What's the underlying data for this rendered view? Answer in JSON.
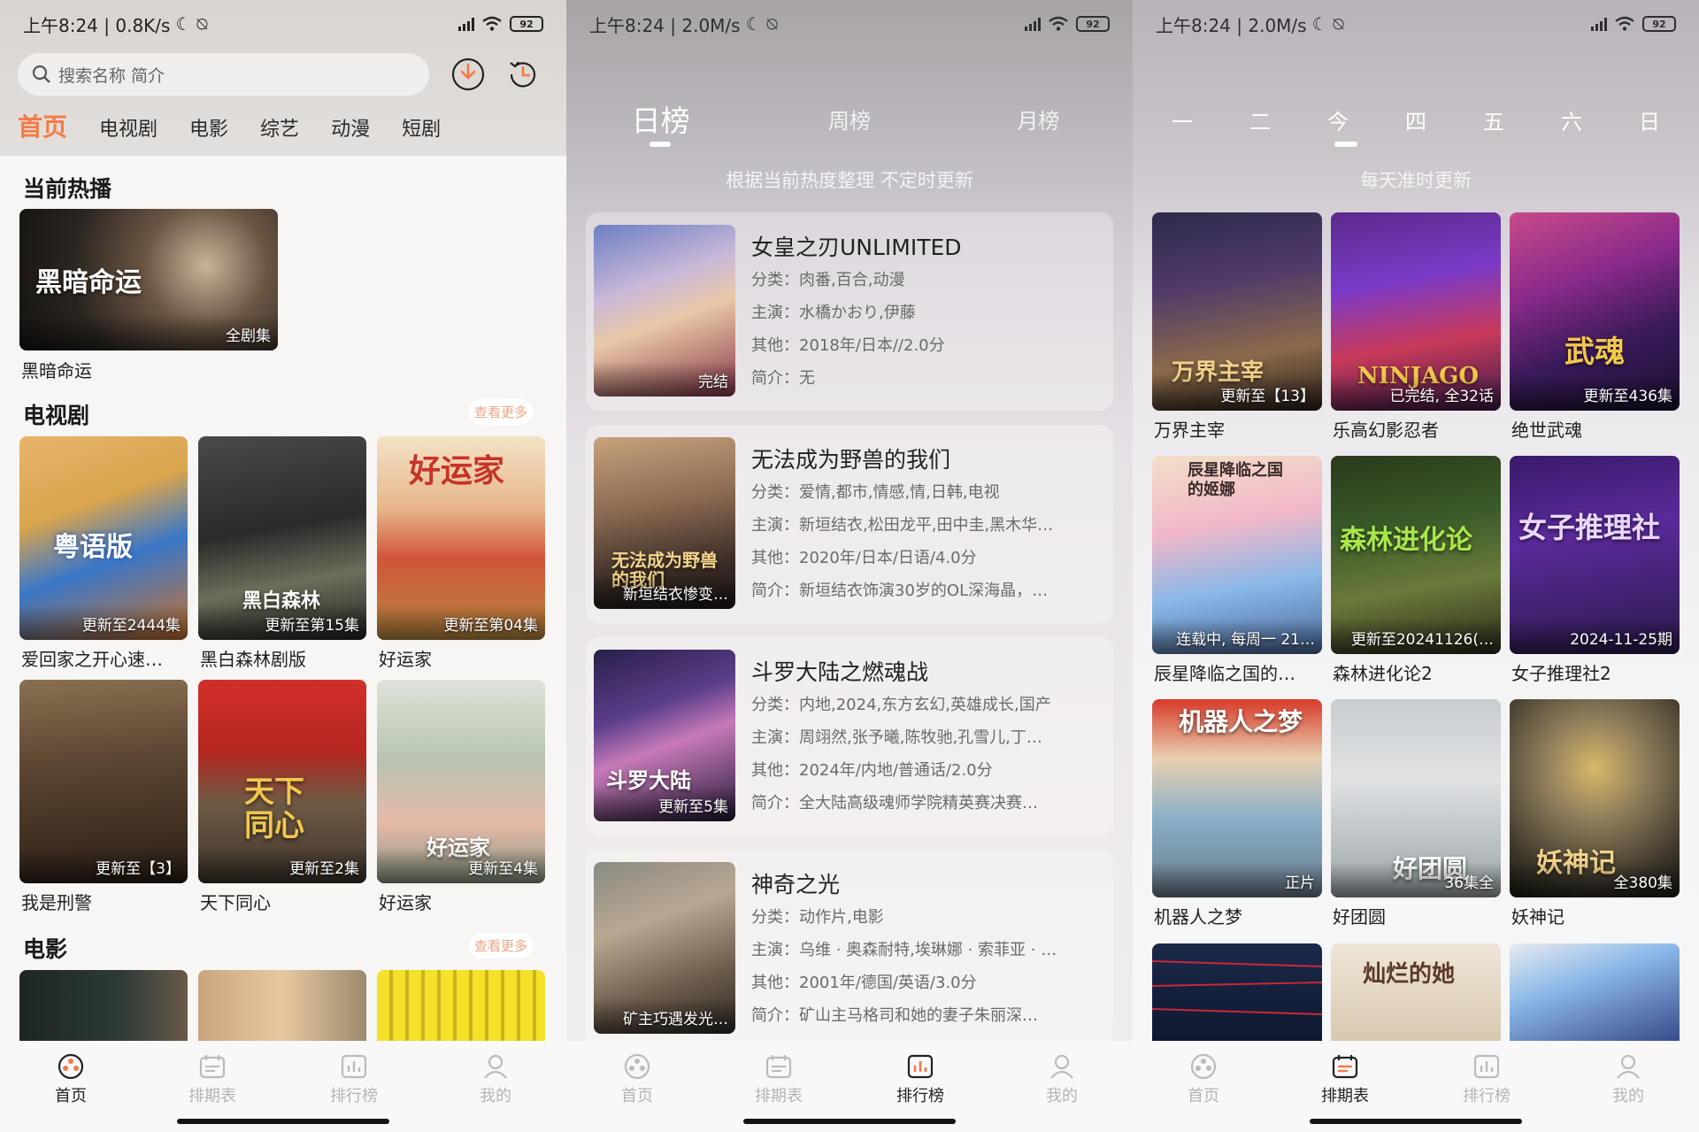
{
  "screens": {
    "home": {
      "status": {
        "time": "上午8:24 | 0.8K/s",
        "battery": "92"
      },
      "search_placeholder": "搜索名称 简介",
      "tabs": [
        "首页",
        "电视剧",
        "电影",
        "综艺",
        "动漫",
        "短剧"
      ],
      "now_playing": {
        "title": "当前热播",
        "item": {
          "poster_text": "黑暗命运",
          "badge": "全剧集",
          "name": "黑暗命运"
        }
      },
      "tv": {
        "title": "电视剧",
        "more": "查看更多",
        "items": [
          {
            "poster_text": "粤语版",
            "badge": "更新至2444集",
            "name": "爱回家之开心速…"
          },
          {
            "poster_text": "黑白森林",
            "badge": "更新至第15集",
            "name": "黑白森林剧版"
          },
          {
            "poster_text": "好运家",
            "badge": "更新至第04集",
            "name": "好运家"
          },
          {
            "poster_text": "",
            "badge": "更新至【3】",
            "name": "我是刑警"
          },
          {
            "poster_text": "天下同心",
            "badge": "更新至2集",
            "name": "天下同心"
          },
          {
            "poster_text": "好运家",
            "badge": "更新至4集",
            "name": "好运家"
          }
        ]
      },
      "movie": {
        "title": "电影",
        "more": "查看更多"
      }
    },
    "ranking": {
      "status": {
        "time": "上午8:24 | 2.0M/s",
        "battery": "92"
      },
      "tabs": [
        "日榜",
        "周榜",
        "月榜"
      ],
      "subtitle": "根据当前热度整理 不定时更新",
      "cards": [
        {
          "title": "女皇之刃UNLIMITED",
          "badge": "完结",
          "category": "分类：肉番,百合,动漫",
          "cast": "主演：水橋かおり,伊藤",
          "other": "其他：2018年/日本//2.0分",
          "intro": "简介：无"
        },
        {
          "title": "无法成为野兽的我们",
          "badge": "新垣结衣惨变…",
          "poster_text": "无法成为野兽的我们",
          "category": "分类：爱情,都市,情感,情,日韩,电视",
          "cast": "主演：新垣结衣,松田龙平,田中圭,黑木华…",
          "other": "其他：2020年/日本/日语/4.0分",
          "intro": "简介：新垣结衣饰演30岁的OL深海晶，…"
        },
        {
          "title": "斗罗大陆之燃魂战",
          "badge": "更新至5集",
          "poster_text": "斗罗大陆",
          "category": "分类：内地,2024,东方玄幻,英雄成长,国产",
          "cast": "主演：周翊然,张予曦,陈牧驰,孔雪儿,丁…",
          "other": "其他：2024年/内地/普通话/2.0分",
          "intro": "简介：全大陆高级魂师学院精英赛决赛…"
        },
        {
          "title": "神奇之光",
          "badge": "矿主巧遇发光…",
          "category": "分类：动作片,电影",
          "cast": "主演：乌维 · 奥森耐特,埃琳娜 · 索菲亚 · …",
          "other": "其他：2001年/德国/英语/3.0分",
          "intro": "简介：矿山主马格司和她的妻子朱丽深…"
        }
      ]
    },
    "schedule": {
      "status": {
        "time": "上午8:24 | 2.0M/s",
        "battery": "92"
      },
      "days": [
        "一",
        "二",
        "今",
        "四",
        "五",
        "六",
        "日"
      ],
      "subtitle": "每天准时更新",
      "items": [
        {
          "poster_text": "万界主宰",
          "badge": "更新至【13】",
          "name": "万界主宰"
        },
        {
          "poster_text": "NINJAGO",
          "badge": "已完结, 全32话",
          "name": "乐高幻影忍者"
        },
        {
          "poster_text": "武魂",
          "badge": "更新至436集",
          "name": "绝世武魂"
        },
        {
          "poster_text": "辰星降临之国的姬娜",
          "badge": "连载中, 每周一 21…",
          "name": "辰星降临之国的…"
        },
        {
          "poster_text": "森林进化论",
          "badge": "更新至20241126(…",
          "name": "森林进化论2"
        },
        {
          "poster_text": "女子推理社",
          "badge": "2024-11-25期",
          "name": "女子推理社2"
        },
        {
          "poster_text": "机器人之梦",
          "badge": "正片",
          "name": "机器人之梦"
        },
        {
          "poster_text": "好团圆",
          "badge": "36集全",
          "name": "好团圆"
        },
        {
          "poster_text": "妖神记",
          "badge": "全380集",
          "name": "妖神记"
        },
        {
          "poster_text": "",
          "badge": "",
          "name": ""
        },
        {
          "poster_text": "灿烂的她",
          "badge": "",
          "name": ""
        },
        {
          "poster_text": "",
          "badge": "",
          "name": ""
        }
      ]
    }
  },
  "nav": [
    "首页",
    "排期表",
    "排行榜",
    "我的"
  ],
  "colors": {
    "accent": "#f47b45",
    "more_link": "#f2a481"
  }
}
